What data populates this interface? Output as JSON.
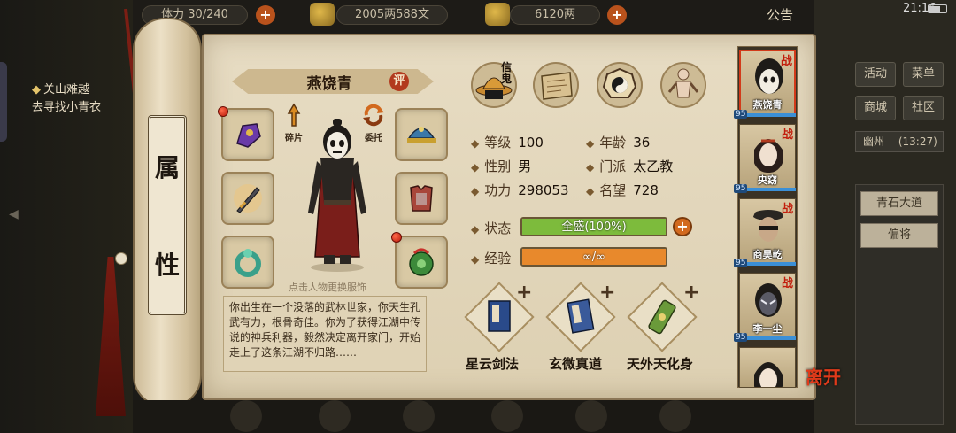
{
  "top_bar": {
    "stamina": "体力 30/240",
    "silver": "2005两588文",
    "gold": "6120两",
    "notice": "公告",
    "time": "21:16"
  },
  "quest": {
    "title": "关山难越",
    "desc": "去寻找小青衣"
  },
  "scroll_label": [
    "属",
    "性"
  ],
  "character": {
    "name": "燕饶青",
    "rate_label": "评",
    "fragment_label": "碎片",
    "delegate_label": "委托",
    "change_hint": "点击人物更换服饰",
    "bio": "你出生在一个没落的武林世家，你天生孔武有力，根骨奇佳。你为了获得江湖中传说的神兵利器，毅然决定离开家门，开始走上了这条江湖不归路……"
  },
  "function_icons": [
    {
      "name": "信鬼",
      "icon": "hat-icon"
    },
    {
      "name": "map",
      "icon": "map-icon"
    },
    {
      "name": "bagua",
      "icon": "bagua-icon"
    },
    {
      "name": "meridian",
      "icon": "body-icon"
    }
  ],
  "stats": {
    "level_label": "等级",
    "level": "100",
    "age_label": "年龄",
    "age": "36",
    "gender_label": "性别",
    "gender": "男",
    "sect_label": "门派",
    "sect": "太乙教",
    "power_label": "功力",
    "power": "298053",
    "fame_label": "名望",
    "fame": "728"
  },
  "status": {
    "label": "状态",
    "text": "全盛(100%)",
    "percent": 100,
    "color": "#7dbb3c"
  },
  "exp": {
    "label": "经验",
    "text": "∞/∞",
    "percent": 100,
    "color": "#e8892c"
  },
  "skills": [
    {
      "name": "星云剑法"
    },
    {
      "name": "玄微真道"
    },
    {
      "name": "天外天化身"
    }
  ],
  "party": [
    {
      "name": "燕饶青",
      "tag": "战",
      "level": "95"
    },
    {
      "name": "央窈",
      "tag": "战",
      "level": "95"
    },
    {
      "name": "商昊乾",
      "tag": "战",
      "level": "95"
    },
    {
      "name": "李一尘",
      "tag": "战",
      "level": "95"
    },
    {
      "name": "",
      "tag": "",
      "level": ""
    }
  ],
  "leave_label": "离开",
  "right_menu": {
    "activity": "活动",
    "menu": "菜单",
    "shop": "商城",
    "community": "社区",
    "location": "幽州",
    "location_time": "(13:27)",
    "items": [
      "青石大道",
      "偏将"
    ]
  },
  "colors": {
    "accent_red": "#b23a1e",
    "parchment": "#e7dcc3"
  }
}
